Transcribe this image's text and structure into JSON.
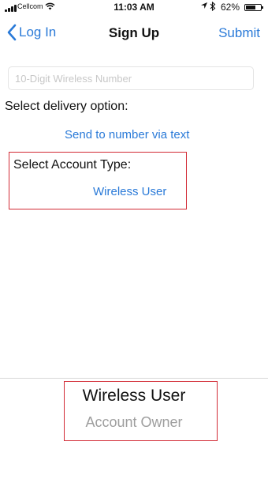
{
  "status_bar": {
    "carrier": "Cellcom",
    "time": "11:03 AM",
    "battery_percent": "62%",
    "icons": [
      "signal-icon",
      "wifi-icon",
      "location-icon",
      "bluetooth-icon",
      "battery-icon"
    ]
  },
  "nav": {
    "back_label": "Log In",
    "title": "Sign Up",
    "submit_label": "Submit"
  },
  "form": {
    "phone_placeholder": "10-Digit Wireless Number",
    "phone_value": "",
    "delivery_label": "Select delivery option:",
    "delivery_value": "Send to number via text",
    "account_label": "Select Account Type:",
    "account_value": "Wireless User"
  },
  "picker": {
    "options": [
      "Wireless User",
      "Account Owner"
    ],
    "selected": "Wireless User"
  },
  "colors": {
    "accent": "#2a7ad8",
    "highlight_box": "#d22b36",
    "placeholder": "#c8c8c8",
    "picker_dim": "#9e9e9e"
  }
}
